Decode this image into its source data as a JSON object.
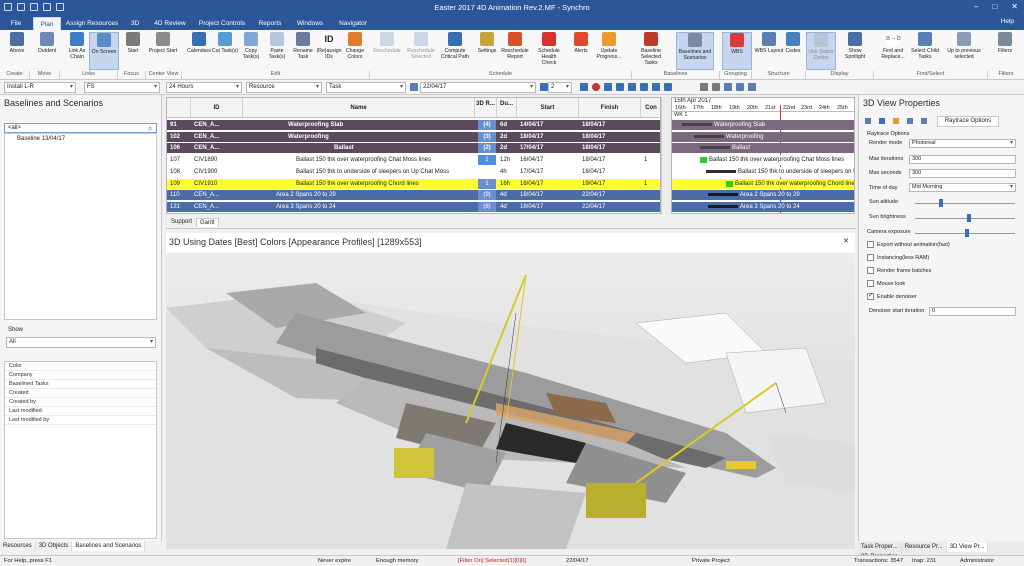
{
  "window": {
    "title": "Easter 2017 4D Animation Rev.2.MF - Synchro",
    "help": "Help"
  },
  "tabs": [
    "File",
    "Plan",
    "Assign Resources",
    "3D",
    "4D Review",
    "Project Controls",
    "Reports",
    "Windows",
    "Navigator"
  ],
  "ribbon": {
    "buttons": [
      "Above",
      "Outdent",
      "Link As Chain",
      "On Screen",
      "Start",
      "Project Start",
      "Calendars",
      "Cut Task(s)",
      "Copy Task(s)",
      "Paste Task(s)",
      "Rename Task",
      "(Re)assign IDs",
      "Change Colors",
      "Reschedule",
      "Reschedule Selected",
      "Compute Critical Path",
      "Settings",
      "Reschedule Report",
      "Schedule Health Check",
      "Alerts",
      "Update Progress...",
      "Baseline Selected Tasks",
      "Baselines and Scenarios",
      "WBS",
      "WBS Layout",
      "Codes",
      "Use Status Codes",
      "Show Spotlight",
      "Find and Replace...",
      "Select Child Tasks",
      "Up to previous selected",
      "Filters"
    ],
    "groups": [
      "Create",
      "Move",
      "Links",
      "Focus",
      "Center View",
      "Edit",
      "Schedule",
      "Baselines",
      "Grouping",
      "Structure",
      "Display",
      "Find/Select",
      "Filters"
    ]
  },
  "toolbar2": {
    "link_type": "Install L-R",
    "relation": "FS",
    "duration": "24 Hours",
    "resource": "Resource",
    "task": "Task",
    "date": "22/04/17",
    "zoom": "2"
  },
  "left_panel": {
    "title": "Baselines and Scenarios",
    "search": "<all>",
    "tree_item": "Baseline 13/04/17",
    "show_label": "Show",
    "show_value": "All",
    "properties": [
      "Color",
      "Company",
      "Baselined Tasks",
      "Created",
      "Created by",
      "Last modified",
      "Last modified by"
    ],
    "tabs": [
      "Resources",
      "3D Objects",
      "Baselines and Scenarios"
    ]
  },
  "grid": {
    "headers": [
      "",
      "ID",
      "Name",
      "3D R...",
      "Du...",
      "Start",
      "Finish",
      "Con"
    ],
    "rows": [
      {
        "num": "91",
        "id": "CEN_A...",
        "name": "Waterproofing Slab",
        "r": "(4)",
        "du": "6d",
        "start": "14/04/17",
        "finish": "18/04/17",
        "con": "",
        "style": "sum"
      },
      {
        "num": "102",
        "id": "CEN_A...",
        "name": "Waterproofing",
        "r": "(3)",
        "du": "2d",
        "start": "18/04/17",
        "finish": "18/04/17",
        "con": "",
        "style": "sum"
      },
      {
        "num": "106",
        "id": "CEN_A...",
        "name": "Ballast",
        "r": "(2)",
        "du": "2d",
        "start": "17/04/17",
        "finish": "18/04/17",
        "con": "",
        "style": "sum"
      },
      {
        "num": "107",
        "id": "CIV1890",
        "name": "Ballast 150 thk over waterproofing Chat Moss lines",
        "r": "1",
        "du": "12h",
        "start": "16/04/17",
        "finish": "18/04/17",
        "con": "1",
        "style": "white"
      },
      {
        "num": "108",
        "id": "CIV1900",
        "name": "Ballast 150 thk to underside of sleepers on Up Chat Moss",
        "r": "",
        "du": "4h",
        "start": "17/04/17",
        "finish": "18/04/17",
        "con": "",
        "style": "white"
      },
      {
        "num": "109",
        "id": "CIV1910",
        "name": "Ballast 150 thk over waterproofing Chord lines",
        "r": "1",
        "du": "16h",
        "start": "18/04/17",
        "finish": "19/04/17",
        "con": "1",
        "style": "sel"
      },
      {
        "num": "110",
        "id": "CEN_A...",
        "name": "Area 2 Spans 20 to 29",
        "r": "(9)",
        "du": "4d",
        "start": "18/04/17",
        "finish": "22/04/17",
        "con": "",
        "style": "blue"
      },
      {
        "num": "131",
        "id": "CEN_A...",
        "name": "Area 3 Spans 20 to 24",
        "r": "(8)",
        "du": "4d",
        "start": "18/04/17",
        "finish": "22/04/17",
        "con": "",
        "style": "blue"
      }
    ]
  },
  "gantt": {
    "header_week": "15th Apr 2017",
    "wk": "WK 1",
    "days": [
      "16th",
      "17th",
      "18th",
      "19th",
      "20th",
      "21st",
      "22nd",
      "23rd",
      "24th",
      "25th"
    ],
    "bars": [
      "Waterproofing Slab",
      "Waterproofing",
      "Ballast",
      "Ballast 150 thk over waterproofing Chat Moss lines",
      "Ballast 150 thk to underside of sleepers on Up Chat Moss",
      "Ballast 150 thk over waterproofing Chord lines",
      "Area 2 Spans 20 to 29",
      "Area 3 Spans 20 to 24"
    ]
  },
  "subtabs": [
    "Support",
    "Gantt"
  ],
  "view3d": {
    "title": "3D Using Dates [Best] Colors [Appearance Profiles] [1289x553]"
  },
  "right_panel": {
    "title": "3D View Properties",
    "active_tab": "Raytrace Options",
    "section": "Raytrace Options",
    "render_mode_label": "Render mode",
    "render_mode": "Photoreal",
    "max_iter_label": "Max iterations",
    "max_iter": "300",
    "max_sec_label": "Max seconds",
    "max_sec": "300",
    "time_label": "Time of day",
    "time": "Mid Morning",
    "sun_alt_label": "Sun altitude",
    "sun_bright_label": "Sun brightness",
    "exposure_label": "Camera exposure",
    "checks": [
      {
        "label": "Export without animation(fast)",
        "checked": false
      },
      {
        "label": "Instancing(less RAM)",
        "checked": false
      },
      {
        "label": "Render frame batches",
        "checked": false
      },
      {
        "label": "Mouse look",
        "checked": false
      },
      {
        "label": "Enable denoiser",
        "checked": true
      }
    ],
    "denoiser_label": "Denoiser start iteration",
    "denoiser": "0",
    "tabs": [
      "Task Proper...",
      "Resource Pr...",
      "3D View Pr...",
      "3D Properties"
    ]
  },
  "status": {
    "help": "For Help, press F1",
    "expire": "Never expire",
    "memory": "Enough memory",
    "filter": "[Filter On] Selected(1)[0|0]",
    "date": "22/04/17",
    "project": "Private Project",
    "transactions": "Transactions: 3547",
    "inap": "Inap: 231",
    "user": "Administrator"
  }
}
